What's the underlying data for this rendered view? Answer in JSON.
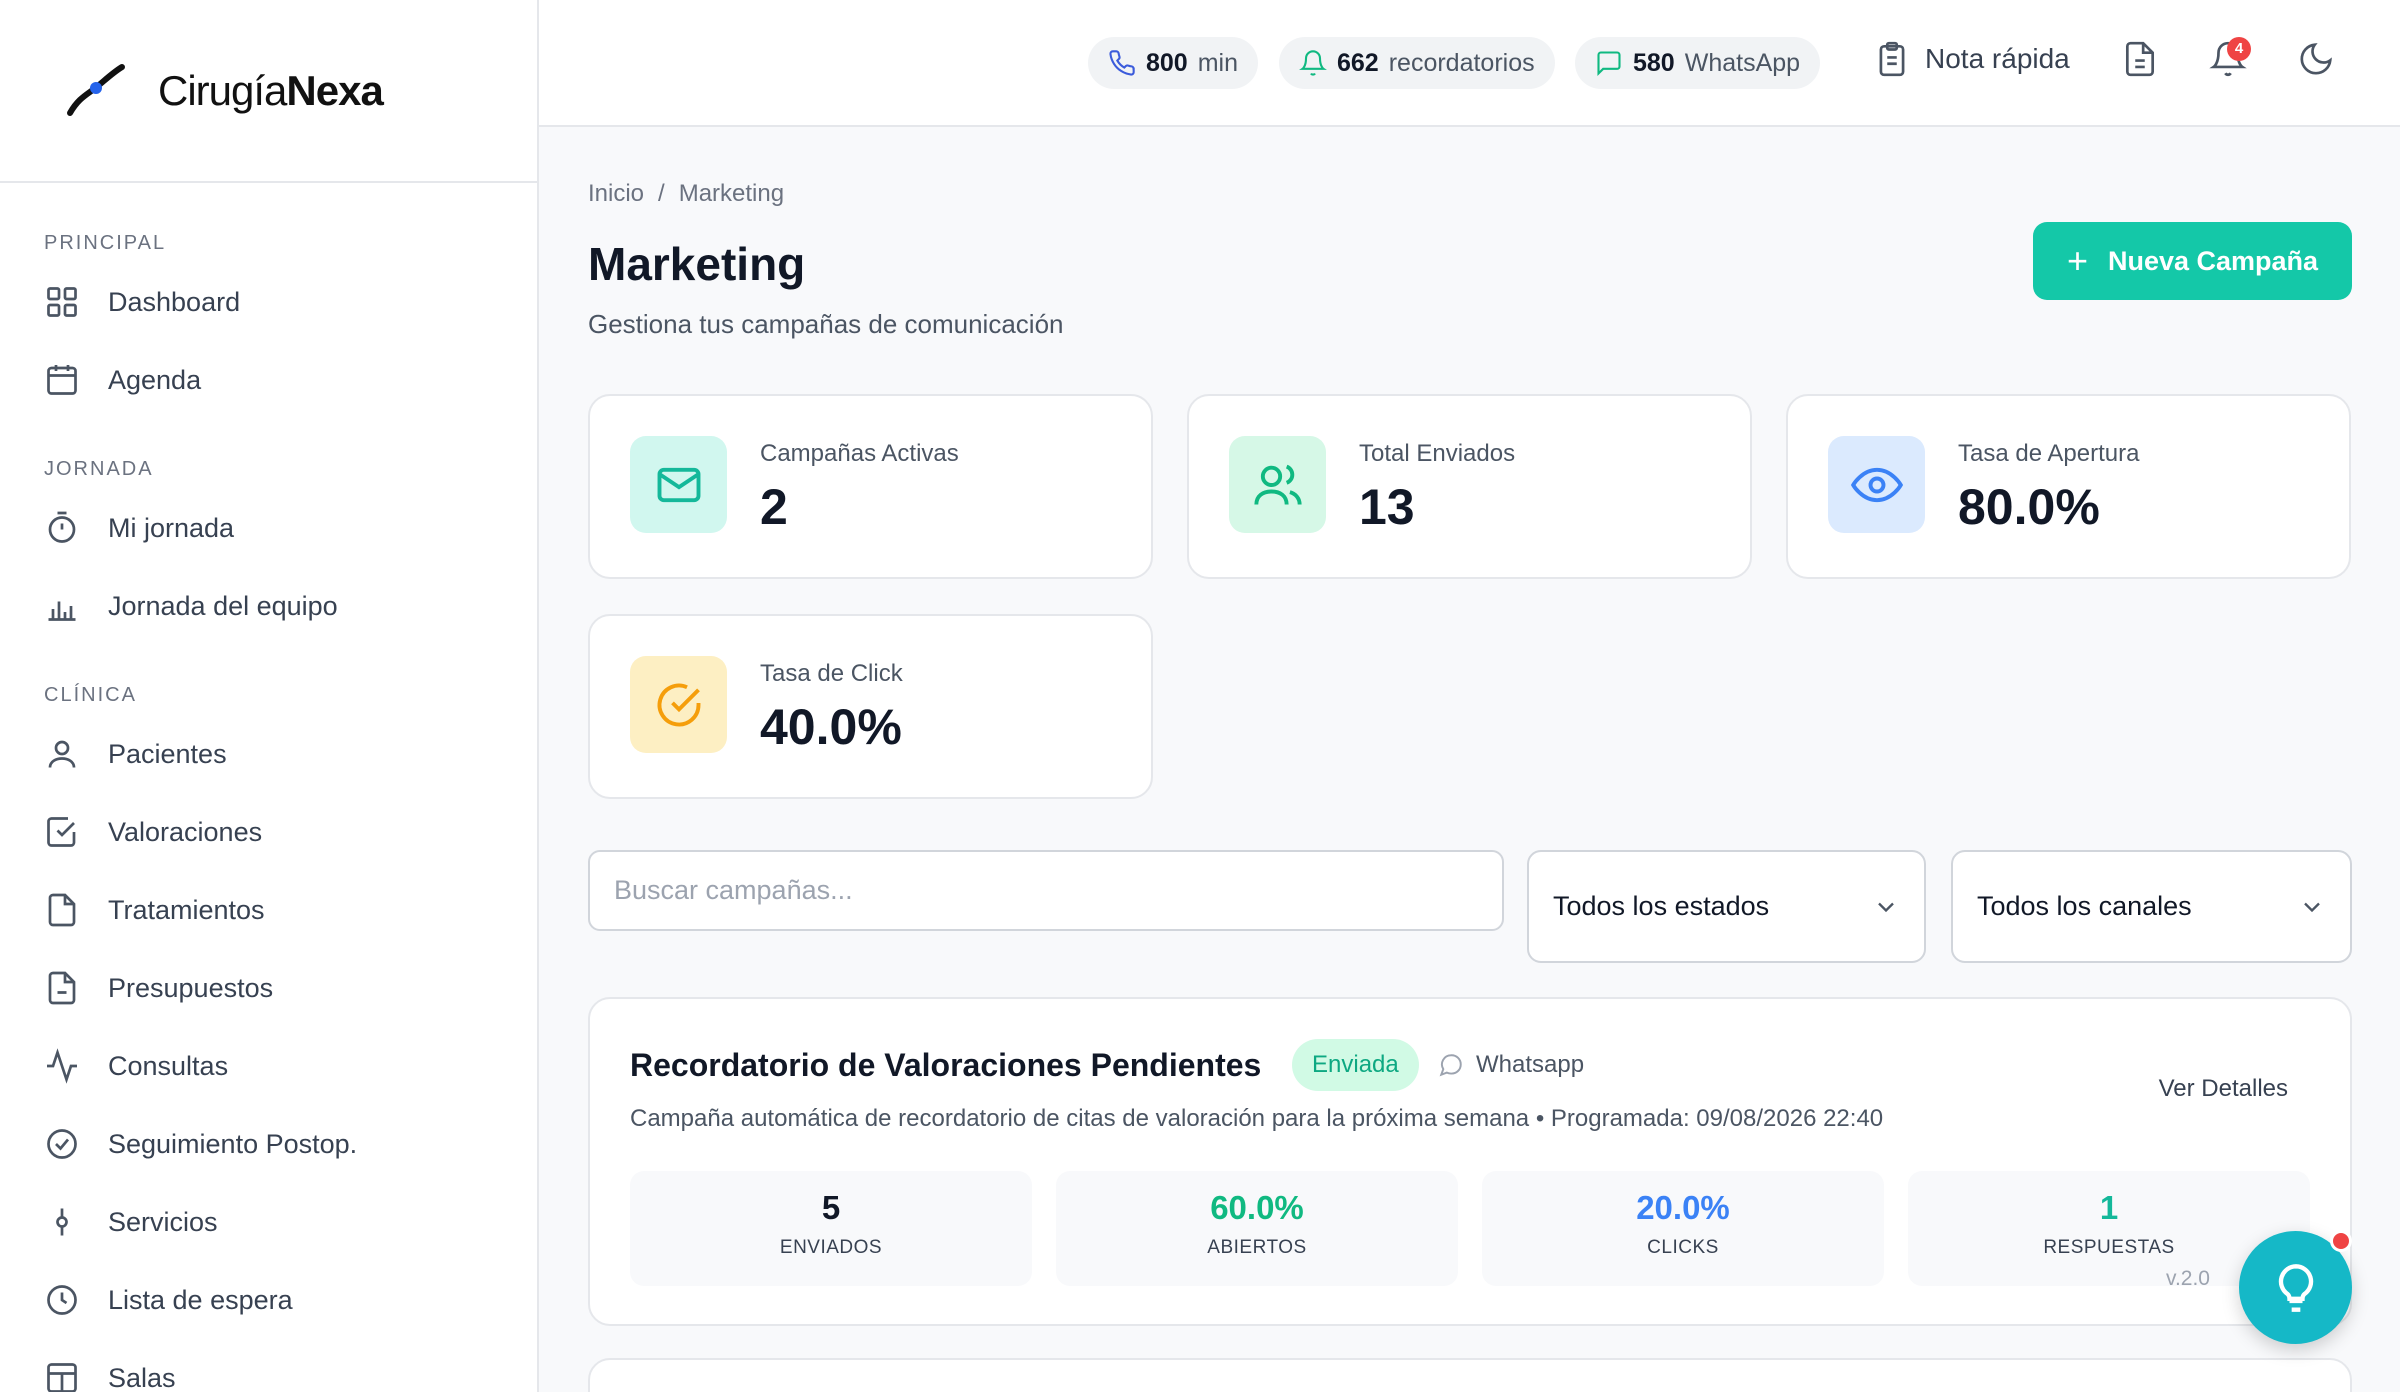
{
  "brand": {
    "name_light": "Cirugía",
    "name_bold": "Nexa"
  },
  "sidebar": {
    "sections": [
      {
        "title": "PRINCIPAL",
        "items": [
          {
            "label": "Dashboard",
            "icon": "grid-icon"
          },
          {
            "label": "Agenda",
            "icon": "calendar-icon"
          }
        ]
      },
      {
        "title": "JORNADA",
        "items": [
          {
            "label": "Mi jornada",
            "icon": "timer-icon"
          },
          {
            "label": "Jornada del equipo",
            "icon": "bar-chart-icon"
          }
        ]
      },
      {
        "title": "CLÍNICA",
        "items": [
          {
            "label": "Pacientes",
            "icon": "user-icon"
          },
          {
            "label": "Valoraciones",
            "icon": "check-square-icon"
          },
          {
            "label": "Tratamientos",
            "icon": "file-icon"
          },
          {
            "label": "Presupuestos",
            "icon": "file-minus-icon"
          },
          {
            "label": "Consultas",
            "icon": "activity-icon"
          },
          {
            "label": "Seguimiento Postop.",
            "icon": "check-circle-icon"
          },
          {
            "label": "Servicios",
            "icon": "git-commit-icon"
          },
          {
            "label": "Lista de espera",
            "icon": "clock-icon"
          },
          {
            "label": "Salas",
            "icon": "layout-icon"
          }
        ]
      }
    ]
  },
  "topbar": {
    "pills": [
      {
        "value": "800",
        "label": "min",
        "icon": "phone-icon"
      },
      {
        "value": "662",
        "label": "recordatorios",
        "icon": "bell-icon"
      },
      {
        "value": "580",
        "label": "WhatsApp",
        "icon": "message-icon"
      }
    ],
    "quick_note": "Nota rápida",
    "notifications_count": "4"
  },
  "breadcrumb": {
    "home": "Inicio",
    "separator": "/",
    "current": "Marketing"
  },
  "page": {
    "title": "Marketing",
    "subtitle": "Gestiona tus campañas de comunicación",
    "new_button": "Nueva Campaña",
    "new_button_icon": "+"
  },
  "stats": [
    {
      "label": "Campañas Activas",
      "value": "2",
      "icon": "mail-icon",
      "bg": "#d1f7ef",
      "fg": "#14b89a"
    },
    {
      "label": "Total Enviados",
      "value": "13",
      "icon": "users-icon",
      "bg": "#d6f8e7",
      "fg": "#10b981"
    },
    {
      "label": "Tasa de Apertura",
      "value": "80.0%",
      "icon": "eye-icon",
      "bg": "#dbeafe",
      "fg": "#3b82f6"
    },
    {
      "label": "Tasa de Click",
      "value": "40.0%",
      "icon": "check-circle-icon",
      "bg": "#fdefc3",
      "fg": "#f59e0b"
    }
  ],
  "filters": {
    "search_placeholder": "Buscar campañas...",
    "status_select": "Todos los estados",
    "channel_select": "Todos los canales"
  },
  "campaign": {
    "title": "Recordatorio de Valoraciones Pendientes",
    "status": "Enviada",
    "channel": "Whatsapp",
    "details_link": "Ver Detalles",
    "description": "Campaña automática de recordatorio de citas de valoración para la próxima semana • Programada: 09/08/2026 22:40",
    "metrics": [
      {
        "value": "5",
        "label": "ENVIADOS",
        "color": "#111827"
      },
      {
        "value": "60.0%",
        "label": "ABIERTOS",
        "color": "#10b981"
      },
      {
        "value": "20.0%",
        "label": "CLICKS",
        "color": "#3b82f6"
      },
      {
        "value": "1",
        "label": "RESPUESTAS",
        "color": "#14b89a"
      }
    ]
  },
  "version": "v.2.0"
}
